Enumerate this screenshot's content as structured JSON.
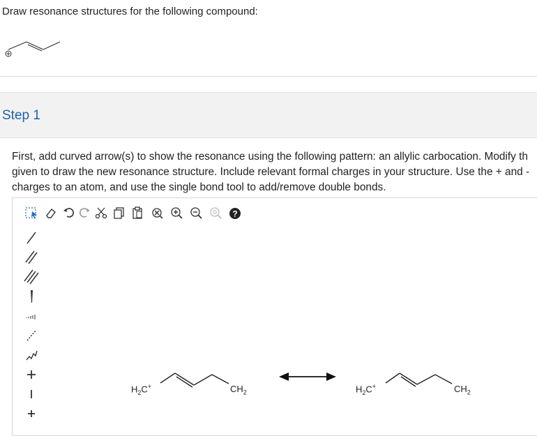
{
  "question": {
    "text": "Draw resonance structures for the following compound:"
  },
  "step": {
    "title": "Step 1",
    "instructions": [
      "First, add curved arrow(s) to show the resonance using the following pattern: an allylic carbocation. Modify th",
      "given to draw the new resonance structure. Include relevant formal charges in your structure. Use the + and -",
      "charges to an atom, and use the single bond tool to add/remove double bonds."
    ]
  },
  "toolbar": {
    "tools": [
      "select-tool",
      "erase-tool",
      "undo-tool",
      "redo-tool",
      "cut-tool",
      "copy-tool",
      "paste-tool",
      "clear-tool",
      "zoom-in-tool",
      "zoom-out-tool",
      "zoom-reset-tool",
      "help-tool"
    ],
    "help_label": "?"
  },
  "left_tools": [
    "single-bond",
    "double-bond",
    "triple-bond",
    "wedge-bond",
    "hash-bond",
    "dashed-bond",
    "chain-tool",
    "plus-charge",
    "minus-charge",
    "plus-minus"
  ],
  "canvas": {
    "structure1": {
      "left_atom": "H",
      "left_sub": "2",
      "left_c": "C",
      "charge": "+",
      "right_c": "CH",
      "right_sub": "2"
    },
    "structure2": {
      "left_atom": "H",
      "left_sub": "2",
      "left_c": "C",
      "charge": "+",
      "right_c": "CH",
      "right_sub": "2"
    }
  },
  "left_tool_symbols": {
    "plus": "+",
    "minus": "−",
    "plusminus": "+"
  }
}
